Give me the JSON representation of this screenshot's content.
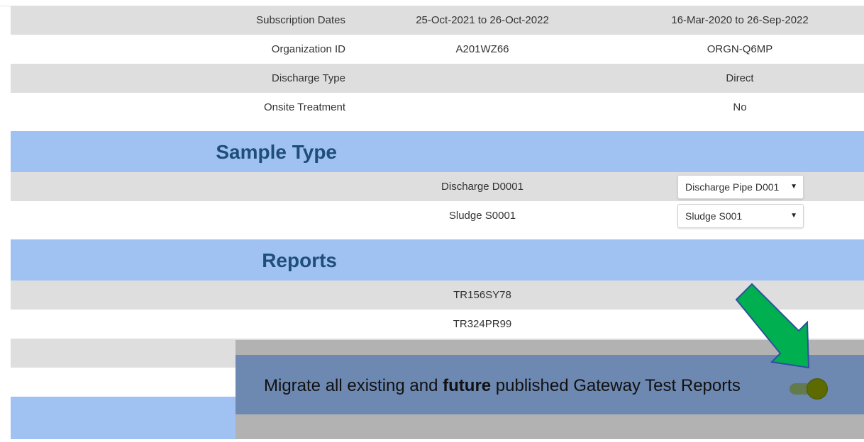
{
  "details": [
    {
      "label": "Subscription Dates",
      "col2": "25-Oct-2021 to 26-Oct-2022",
      "col3": "16-Mar-2020 to 26-Sep-2022"
    },
    {
      "label": "Organization ID",
      "col2": "A201WZ66",
      "col3": "ORGN-Q6MP"
    },
    {
      "label": "Discharge Type",
      "col2": "",
      "col3": "Direct"
    },
    {
      "label": "Onsite Treatment",
      "col2": "",
      "col3": "No"
    }
  ],
  "sample_type": {
    "title": "Sample Type",
    "rows": [
      {
        "name": "Discharge D0001",
        "selected": "Discharge Pipe D001"
      },
      {
        "name": "Sludge S0001",
        "selected": "Sludge S001"
      }
    ]
  },
  "reports": {
    "title": "Reports",
    "items": [
      "TR156SY78",
      "TR324PR99"
    ]
  },
  "migrate": {
    "text_before": "Migrate all existing and ",
    "text_bold": "future",
    "text_after": " published Gateway Test Reports",
    "toggle_on": true
  },
  "colors": {
    "section_bg": "#9fc2f3",
    "section_title": "#1f4e79",
    "overlay_bg": "#6d88b1",
    "arrow": "#00b050"
  }
}
